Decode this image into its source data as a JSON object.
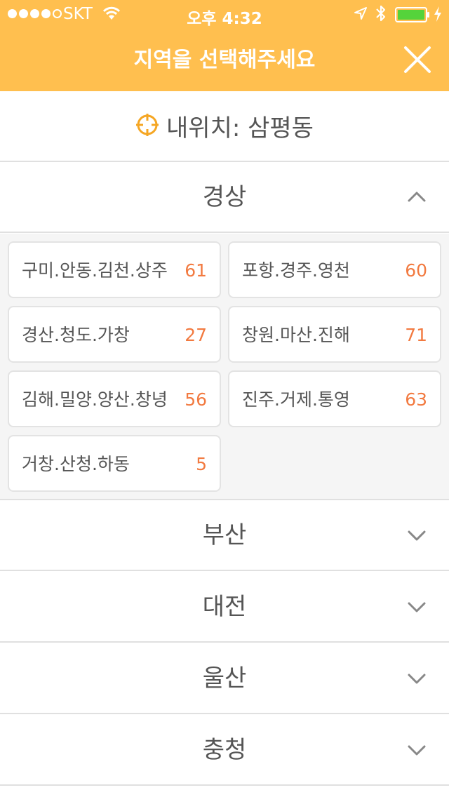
{
  "status_bar": {
    "carrier": "SKT",
    "time": "오후 4:32"
  },
  "header": {
    "title": "지역을 선택해주세요"
  },
  "my_location": {
    "label": "내위치: 삼평동"
  },
  "sections": [
    {
      "name": "경상",
      "expanded": true
    },
    {
      "name": "부산",
      "expanded": false
    },
    {
      "name": "대전",
      "expanded": false
    },
    {
      "name": "울산",
      "expanded": false
    },
    {
      "name": "충청",
      "expanded": false
    }
  ],
  "regions": [
    {
      "name": "구미.안동.김천.상주",
      "count": "61"
    },
    {
      "name": "포항.경주.영천",
      "count": "60"
    },
    {
      "name": "경산.청도.가창",
      "count": "27"
    },
    {
      "name": "창원.마산.진해",
      "count": "71"
    },
    {
      "name": "김해.밀양.양산.창녕",
      "count": "56"
    },
    {
      "name": "진주.거제.통영",
      "count": "63"
    },
    {
      "name": "거창.산청.하동",
      "count": "5"
    }
  ],
  "colors": {
    "header": "#ffbf4f",
    "accent_count": "#f27a40",
    "location_icon": "#f5a623"
  },
  "icons": {
    "wifi": "wifi-icon",
    "location": "location-arrow-icon",
    "bluetooth": "bluetooth-icon",
    "battery": "battery-icon",
    "close": "close-icon",
    "my_location": "crosshair-icon",
    "expanded": "chevron-up-icon",
    "collapsed": "chevron-down-icon"
  }
}
